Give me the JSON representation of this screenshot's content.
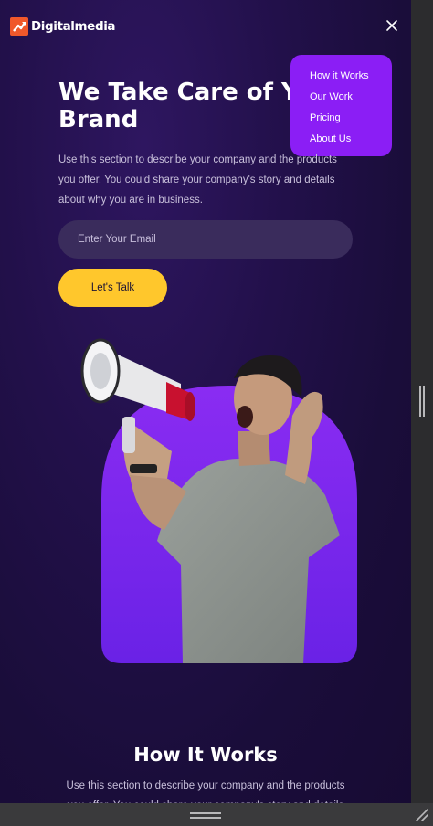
{
  "brand": {
    "name": "Digitalmedia"
  },
  "menu": {
    "items": [
      "How it Works",
      "Our Work",
      "Pricing",
      "About Us"
    ]
  },
  "hero": {
    "title_line1": "We Take Care of Yo",
    "title_line2": "Brand",
    "description": "Use this section to describe your company and the products you offer. You could share your company's story and details about why you are in business.",
    "email_placeholder": "Enter Your Email",
    "cta_label": "Let's Talk"
  },
  "how_it_works": {
    "title": "How It Works",
    "description": "Use this section to describe your company and the products you offer. You could share your company's story and details"
  },
  "icons": {
    "logo": "digitalmedia-logo-icon",
    "close": "close-icon",
    "scroll_handle": "scrollbar-handle-icon",
    "resize": "resize-grip-icon"
  },
  "colors": {
    "background": "#1a0d3a",
    "accent_purple": "#8b1ef5",
    "cta_yellow": "#ffc72c",
    "logo_orange": "#f0582b",
    "input_bg": "#3a2c5c"
  }
}
